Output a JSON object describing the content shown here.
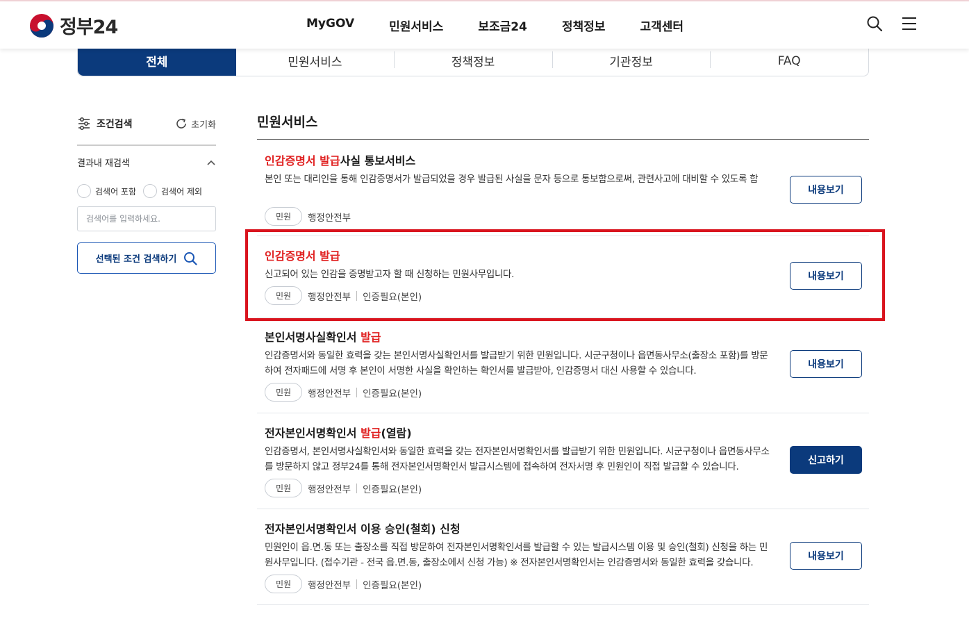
{
  "header": {
    "logo_text": "정부24",
    "nav": [
      "MyGOV",
      "민원서비스",
      "보조금24",
      "정책정보",
      "고객센터"
    ],
    "icons": [
      "search-icon",
      "menu-icon"
    ]
  },
  "tabs": [
    {
      "label": "전체",
      "active": true
    },
    {
      "label": "민원서비스",
      "active": false
    },
    {
      "label": "정책정보",
      "active": false
    },
    {
      "label": "기관정보",
      "active": false
    },
    {
      "label": "FAQ",
      "active": false
    }
  ],
  "sidebar": {
    "title": "조건검색",
    "reset_label": "초기화",
    "subsection_label": "결과내 재검색",
    "radio_include": "검색어 포함",
    "radio_exclude": "검색어 제외",
    "search_placeholder": "검색어를 입력하세요.",
    "search_button": "선택된 조건 검색하기"
  },
  "main": {
    "section_title": "민원서비스",
    "items": [
      {
        "title_parts": [
          {
            "text": "인감증명서 발급",
            "hl": true
          },
          {
            "text": "사실 통보서비스",
            "hl": false
          }
        ],
        "desc": "본인 또는 대리인을 통해 인감증명서가 발급되었을 경우 발급된 사실을 문자 등으로 통보함으로써, 관련사고에 대비할 수 있도록 함",
        "badge": "민원",
        "org": "행정안전부",
        "auth": "",
        "button": "내용보기",
        "primary": false
      },
      {
        "title_parts": [
          {
            "text": "인감증명서 발급",
            "hl": true
          }
        ],
        "desc": "신고되어 있는 인감을 증명받고자 할 때 신청하는 민원사무입니다.",
        "badge": "민원",
        "org": "행정안전부",
        "auth": "인증필요(본인)",
        "button": "내용보기",
        "primary": false
      },
      {
        "title_parts": [
          {
            "text": "본인서명사실확인서 ",
            "hl": false
          },
          {
            "text": "발급",
            "hl": true
          }
        ],
        "desc": "인감증명서와 동일한 효력을 갖는 본인서명사실확인서를 발급받기 위한 민원입니다. 시군구청이나 읍면동사무소(출장소 포함)를 방문하여 전자패드에 서명 후 본인이 서명한 사실을 확인하는 확인서를 발급받아, 인감증명서 대신 사용할 수 있습니다.",
        "badge": "민원",
        "org": "행정안전부",
        "auth": "인증필요(본인)",
        "button": "내용보기",
        "primary": false
      },
      {
        "title_parts": [
          {
            "text": "전자본인서명확인서 ",
            "hl": false
          },
          {
            "text": "발급",
            "hl": true
          },
          {
            "text": "(열람)",
            "hl": false
          }
        ],
        "desc": "인감증명서, 본인서명사실확인서와 동일한 효력을 갖는 전자본인서명확인서를 발급받기 위한 민원입니다. 시군구청이나 읍면동사무소를 방문하지 않고 정부24를 통해 전자본인서명확인서 발급시스템에 접속하여 전자서명 후 민원인이 직접 발급할 수 있습니다.",
        "badge": "민원",
        "org": "행정안전부",
        "auth": "인증필요(본인)",
        "button": "신고하기",
        "primary": true
      },
      {
        "title_parts": [
          {
            "text": "전자본인서명확인서 이용 승인(철회) 신청",
            "hl": false
          }
        ],
        "desc": "민원인이 읍.면.동 또는 출장소를 직접 방문하여 전자본인서명확인서를 발급할 수 있는 발급시스템 이용 및 승인(철회) 신청을 하는 민원사무입니다. (접수기관 - 전국 읍.면.동, 출장소에서 신청 가능) ※ 전자본인서명확인서는 인감증명서와 동일한 효력을 갖습니다.",
        "badge": "민원",
        "org": "행정안전부",
        "auth": "인증필요(본인)",
        "button": "내용보기",
        "primary": false
      }
    ]
  },
  "colors": {
    "brand": "#0b3a7c",
    "highlight": "#e02020",
    "annotation_box": "#d9141e"
  }
}
